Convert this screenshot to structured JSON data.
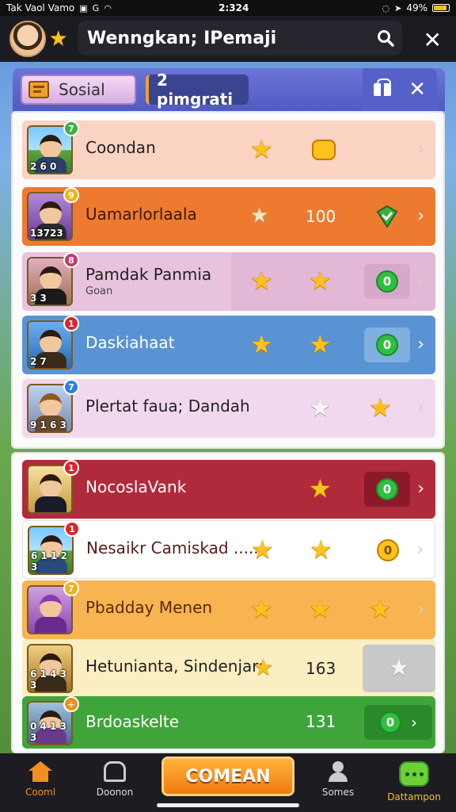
{
  "status_bar": {
    "carrier": "Tak Vaol Vamo",
    "time": "2:324",
    "battery": "49%"
  },
  "top_bar": {
    "title": "Wenngkan; IPemaji"
  },
  "panel": {
    "tab_social": "Sosial",
    "tab_programs": "2 pimgrati"
  },
  "list_1": [
    {
      "name": "Coondan",
      "sub": "",
      "badge": "7",
      "badge_color": "#3cb043",
      "portrait_num": "2 6 0",
      "bg": "#fad3c3",
      "value": ""
    },
    {
      "name": "Uamarlorlaala",
      "sub": "",
      "badge": "9",
      "badge_color": "#f0b020",
      "portrait_num": "13723",
      "bg": "#ee7a30",
      "value": "100"
    },
    {
      "name": "Pamdak Panmia",
      "sub": "Goan",
      "badge": "8",
      "badge_color": "#c43a6a",
      "portrait_num": "3 3",
      "bg": "#e7c3dd",
      "value": ""
    },
    {
      "name": "Daskiahaat",
      "sub": "",
      "badge": "1",
      "badge_color": "#d9262b",
      "portrait_num": "2 7",
      "bg": "#5a93d4",
      "value": ""
    },
    {
      "name": "Plertat faua; Dandah",
      "sub": "",
      "badge": "7",
      "badge_color": "#2f7fe0",
      "portrait_num": "9 1 6 3",
      "bg": "#f2d8ef",
      "value": ""
    }
  ],
  "list_2": [
    {
      "name": "NocoslaVank",
      "badge": "1",
      "badge_color": "#d9262b",
      "portrait_num": "",
      "bg": "#b02a3c",
      "value": ""
    },
    {
      "name": "Nesaikr Camiskad .....",
      "badge": "1",
      "badge_color": "#d9262b",
      "portrait_num": "6 1 1 2 3",
      "bg": "#ffffff",
      "value": ""
    },
    {
      "name": "Pbadday Menen",
      "badge": "7",
      "badge_color": "#f0b020",
      "portrait_num": "",
      "bg": "#f7b451",
      "value": ""
    },
    {
      "name": "Hetunianta, Sindenjar:",
      "badge": "",
      "badge_color": "#3cb043",
      "portrait_num": "6 1 4 3 3",
      "bg": "#fbeec2",
      "value": "163"
    },
    {
      "name": "Brdoaskelte",
      "badge": "+",
      "badge_color": "#f09020",
      "portrait_num": "0 4 1 3 3",
      "bg": "#3fa53a",
      "value": "131"
    }
  ],
  "coins": {
    "coin_0": "0"
  },
  "bottom_nav": {
    "item_1": "Cooml",
    "item_2": "Doonon",
    "center": "COMEAN",
    "item_4": "Somes",
    "item_5": "Dattampon"
  },
  "colors": {
    "accent": "#f07a10",
    "panel_header": "#5561c8",
    "star": "#ffc21a",
    "coin_green": "#2fbf40"
  },
  "icons": [
    "search-icon",
    "close-icon",
    "star-icon",
    "gift-icon",
    "chevron-right-icon",
    "home-icon",
    "house-icon",
    "people-icon",
    "chat-icon",
    "coin-icon",
    "shield-check-icon"
  ]
}
